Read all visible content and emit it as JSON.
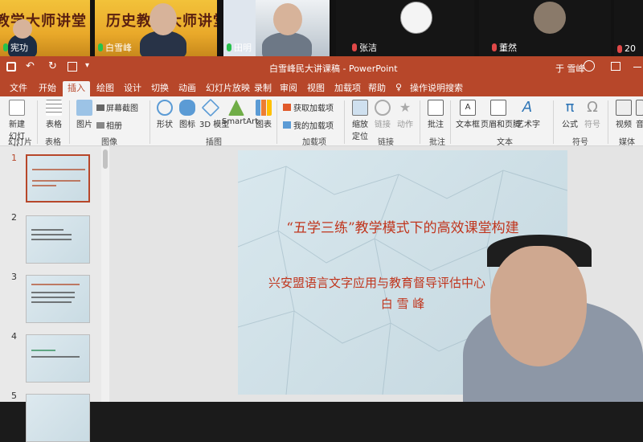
{
  "meeting": {
    "tiles": [
      {
        "name": "宪功",
        "banner": "教学大师讲堂"
      },
      {
        "name": "白雪峰",
        "banner": "历史教学大师讲堂"
      },
      {
        "name": "田明"
      },
      {
        "name": "张洁"
      },
      {
        "name": "董然"
      },
      {
        "name": "20"
      }
    ]
  },
  "window": {
    "title": "白雪峰民大讲课稿 - PowerPoint",
    "user": "于 雪峰"
  },
  "tabs": [
    "文件",
    "开始",
    "插入",
    "绘图",
    "设计",
    "切换",
    "动画",
    "幻灯片放映",
    "录制",
    "审阅",
    "视图",
    "加载项",
    "帮助",
    "操作说明搜索"
  ],
  "ribbon": {
    "buttons": [
      "新建幻灯片",
      "表格",
      "图片",
      "屏幕截图",
      "相册",
      "形状",
      "图标",
      "3D 模型",
      "SmartArt",
      "图表",
      "获取加载项",
      "我的加载项",
      "缩放定位",
      "链接",
      "动作",
      "批注",
      "文本框",
      "页眉和页脚",
      "艺术字",
      "公式",
      "符号",
      "视频",
      "音"
    ],
    "groups": [
      "幻灯片",
      "表格",
      "图像",
      "插图",
      "加载项",
      "链接",
      "批注",
      "文本",
      "符号",
      "媒体"
    ]
  },
  "thumbnails": [
    "1",
    "2",
    "3",
    "4",
    "5"
  ],
  "slide": {
    "title": "“五学三练”教学模式下的高效课堂构建",
    "subtitle": "兴安盟语言文字应用与教育督导评估中心",
    "author": "白 雪 峰"
  },
  "colors": {
    "accent": "#b7472a",
    "slide_text": "#c0351d"
  }
}
